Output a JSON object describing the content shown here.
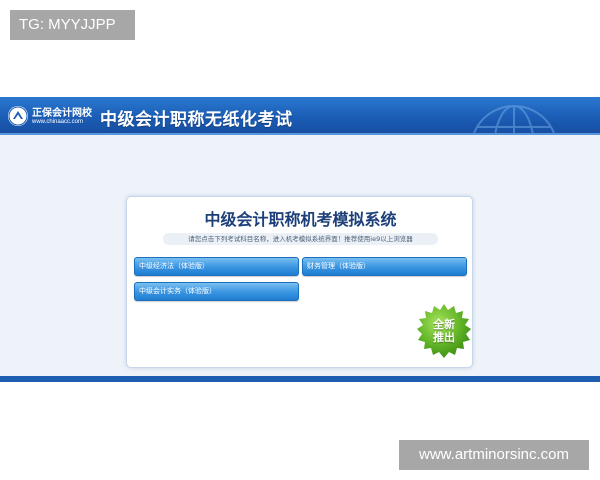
{
  "watermarks": {
    "top_left": "TG: MYYJJPP",
    "bottom_right": "www.artminorsinc.com"
  },
  "header": {
    "logo_name": "正保会计网校",
    "logo_url": "www.chinaacc.com",
    "title": "中级会计职称无纸化考试"
  },
  "panel": {
    "title": "中级会计职称机考模拟系统",
    "subtitle": "请您点击下列考试科目名称，进入机考模拟系统界面！推荐使用ie9以上浏览器"
  },
  "exams": [
    {
      "label": "中级经济法（体验版）"
    },
    {
      "label": "财务管理（体验版）"
    },
    {
      "label": "中级会计实务（体验版）"
    }
  ],
  "badge": {
    "line1": "全新",
    "line2": "推出"
  },
  "colors": {
    "header_blue": "#1b5db6",
    "button_blue": "#3d97e2",
    "title_navy": "#1c3f7a",
    "badge_green": "#5fb226"
  }
}
